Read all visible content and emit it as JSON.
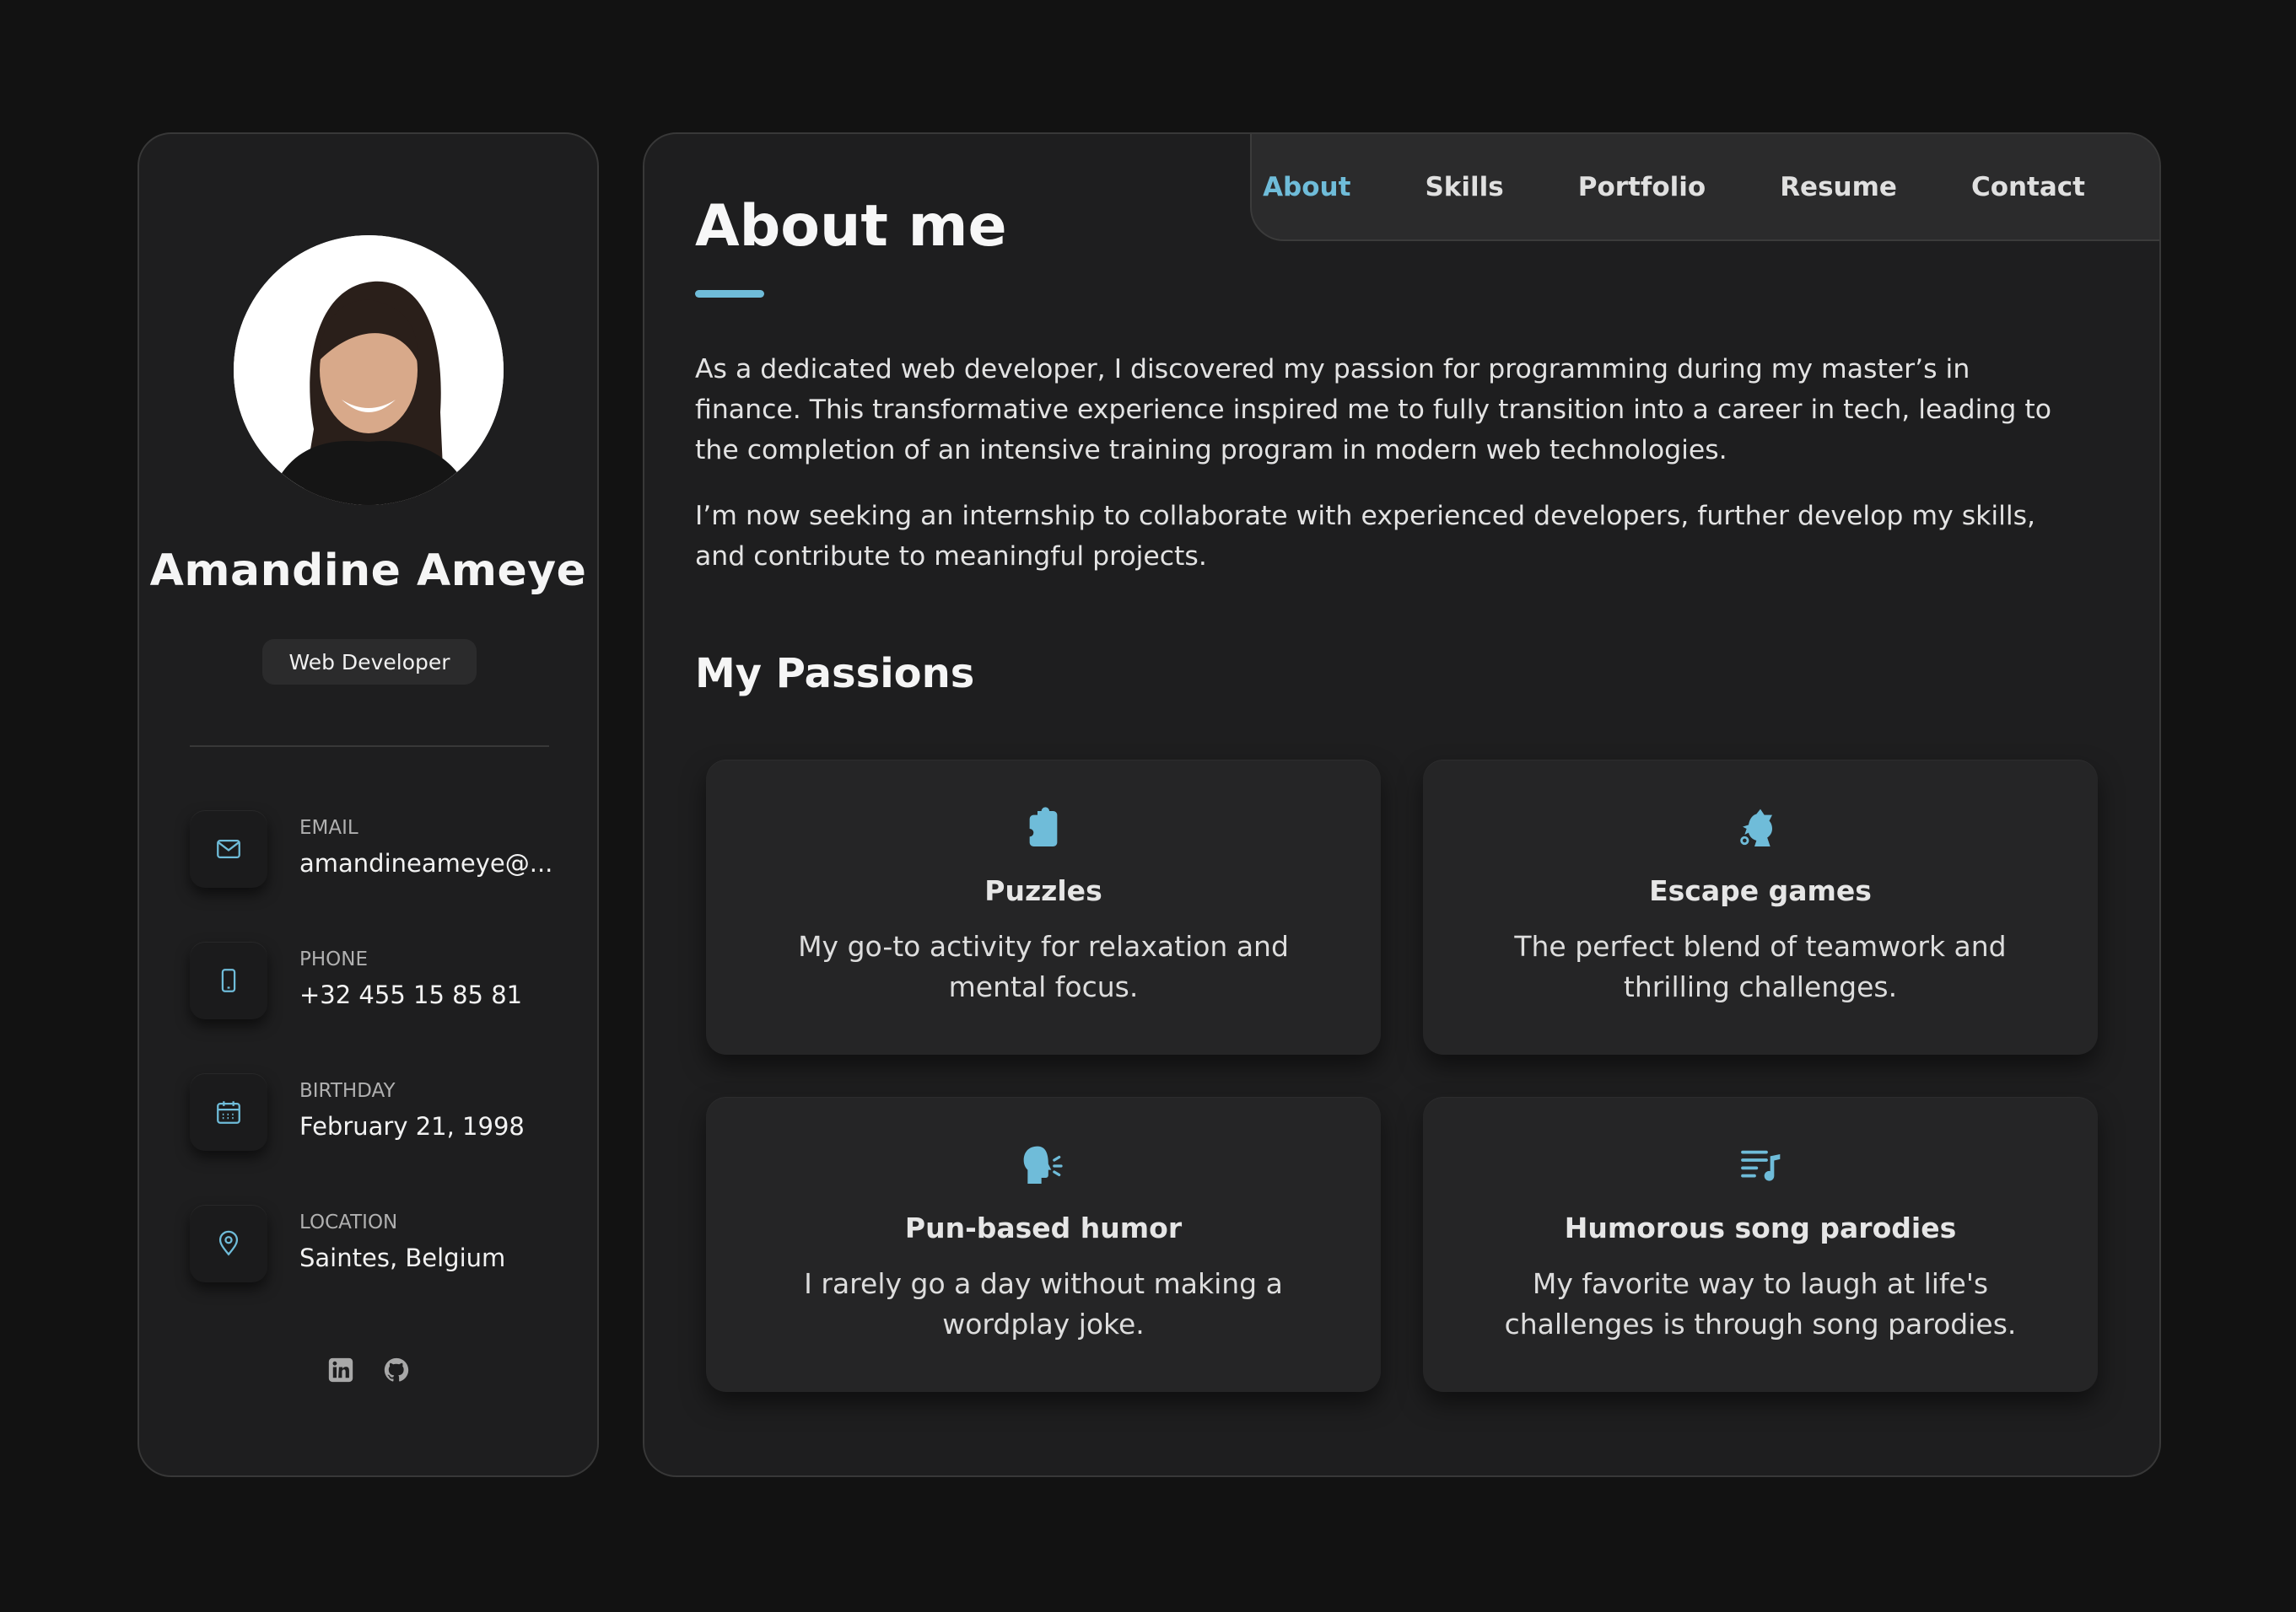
{
  "profile": {
    "name": "Amandine Ameye",
    "role": "Web Developer"
  },
  "contacts": [
    {
      "label": "EMAIL",
      "value": "amandineameye@...",
      "icon": "mail-icon"
    },
    {
      "label": "PHONE",
      "value": "+32 455 15 85 81",
      "icon": "phone-icon"
    },
    {
      "label": "BIRTHDAY",
      "value": "February 21, 1998",
      "icon": "calendar-icon"
    },
    {
      "label": "LOCATION",
      "value": "Saintes, Belgium",
      "icon": "location-pin-icon"
    }
  ],
  "socials": [
    {
      "icon": "linkedin-icon"
    },
    {
      "icon": "github-icon"
    }
  ],
  "nav": {
    "items": [
      "About",
      "Skills",
      "Portfolio",
      "Resume",
      "Contact"
    ],
    "active": "About"
  },
  "about": {
    "title": "About me",
    "paragraphs": [
      "As a dedicated web developer, I discovered my passion for programming during my master’s in finance. This transformative experience inspired me to fully transition into a career in tech, leading to the completion of an intensive training program in modern web technologies.",
      "I’m now seeking an internship to collaborate with experienced developers, further develop my skills, and contribute to meaningful projects."
    ]
  },
  "passions": {
    "title": "My Passions",
    "items": [
      {
        "title": "Puzzles",
        "description": "My go-to activity for relaxation and mental focus.",
        "icon": "puzzle-piece-icon"
      },
      {
        "title": "Escape games",
        "description": "The perfect blend of teamwork and thrilling challenges.",
        "icon": "detective-icon"
      },
      {
        "title": "Pun-based humor",
        "description": "I rarely go a day without making a wordplay joke.",
        "icon": "speaking-head-icon"
      },
      {
        "title": "Humorous song parodies",
        "description": "My favorite way to laugh at life's challenges is through song parodies.",
        "icon": "music-list-icon"
      }
    ]
  },
  "colors": {
    "background": "#121212",
    "card": "#1e1e1f",
    "accent": "#6fbcd9"
  }
}
